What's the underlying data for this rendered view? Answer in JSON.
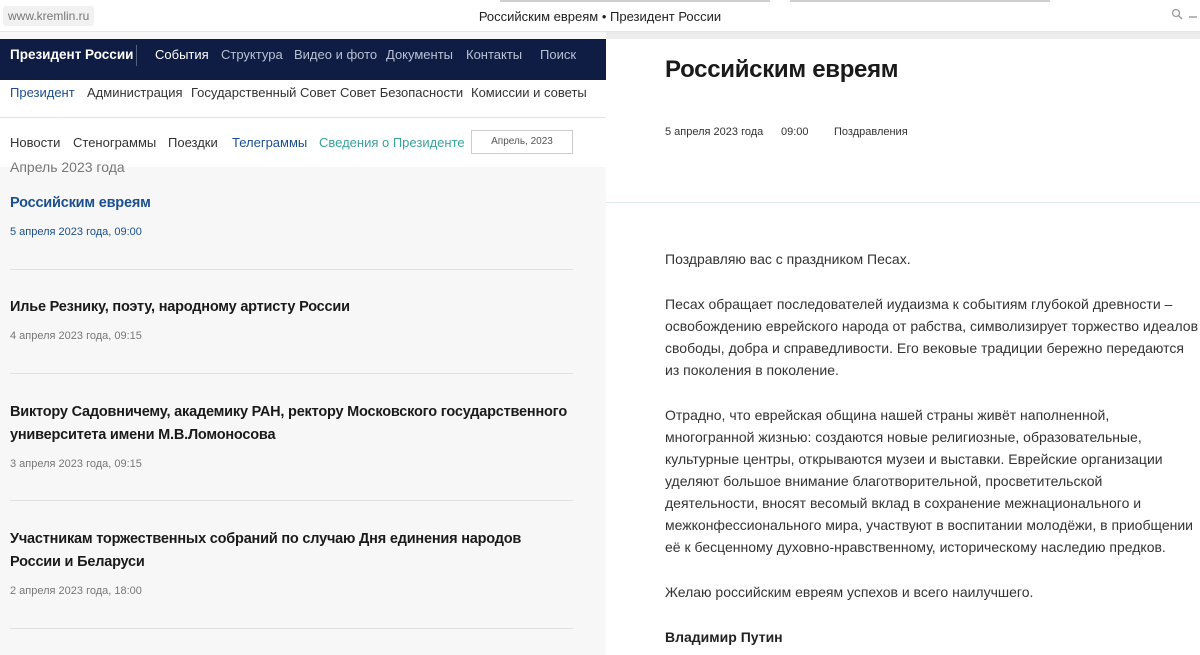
{
  "browser": {
    "url": "www.kremlin.ru",
    "window_title": "Российским евреям • Президент России"
  },
  "topnav": {
    "brand": "Президент России",
    "items": [
      {
        "label": "События",
        "active": true
      },
      {
        "label": "Структура",
        "active": false
      },
      {
        "label": "Видео и фото",
        "active": false
      },
      {
        "label": "Документы",
        "active": false
      },
      {
        "label": "Контакты",
        "active": false
      },
      {
        "label": "Поиск",
        "active": false
      }
    ]
  },
  "subnav": {
    "items": [
      {
        "label": "Президент",
        "active": true
      },
      {
        "label": "Администрация",
        "active": false
      },
      {
        "label": "Государственный Совет",
        "active": false
      },
      {
        "label": "Совет Безопасности",
        "active": false
      },
      {
        "label": "Комиссии и советы",
        "active": false
      }
    ]
  },
  "secnav": {
    "items": [
      {
        "label": "Новости"
      },
      {
        "label": "Стенограммы"
      },
      {
        "label": "Поездки"
      },
      {
        "label": "Телеграммы"
      },
      {
        "label": "Сведения о Президенте"
      }
    ],
    "date_filter": "Апрель, 2023"
  },
  "list": {
    "month_label": "Апрель 2023 года",
    "entries": [
      {
        "title": "Российским евреям",
        "date": "5 апреля 2023 года, 09:00",
        "current": true
      },
      {
        "title": "Илье Резнику, поэту, народному артисту России",
        "date": "4 апреля 2023 года, 09:15",
        "current": false
      },
      {
        "title": "Виктору Садовничему, академику РАН, ректору Московского государственного университета имени М.В.Ломоносова",
        "date": "3 апреля 2023 года, 09:15",
        "current": false
      },
      {
        "title": "Участникам торжественных собраний по случаю Дня единения народов России и Беларуси",
        "date": "2 апреля 2023 года, 18:00",
        "current": false
      }
    ]
  },
  "article": {
    "title": "Российским евреям",
    "date": "5 апреля 2023 года",
    "time": "09:00",
    "category": "Поздравления",
    "paragraphs": [
      "Поздравляю вас с праздником Песах.",
      "Песах обращает последователей иудаизма к событиям глубокой древности – освобождению еврейского народа от рабства, символизирует торжество идеалов свободы, добра и справедливости. Его вековые традиции бережно передаются из поколения в поколение.",
      "Отрадно, что еврейская община нашей страны живёт наполненной, многогранной жизнью: создаются новые религиозные, образовательные, культурные центры, открываются музеи и выставки. Еврейские организации уделяют большое внимание благотворительной, просветительской деятельности, вносят весомый вклад в сохранение межнационального и межконфессионального мира, участвуют в воспитании молодёжи, в приобщении её к бесценному духовно-нравственному, историческому наследию предков.",
      "Желаю российским евреям успехов и всего наилучшего."
    ],
    "signature": "Владимир Путин"
  },
  "icons": {
    "zoom": "zoom-icon",
    "minimize": "minimize-icon"
  }
}
